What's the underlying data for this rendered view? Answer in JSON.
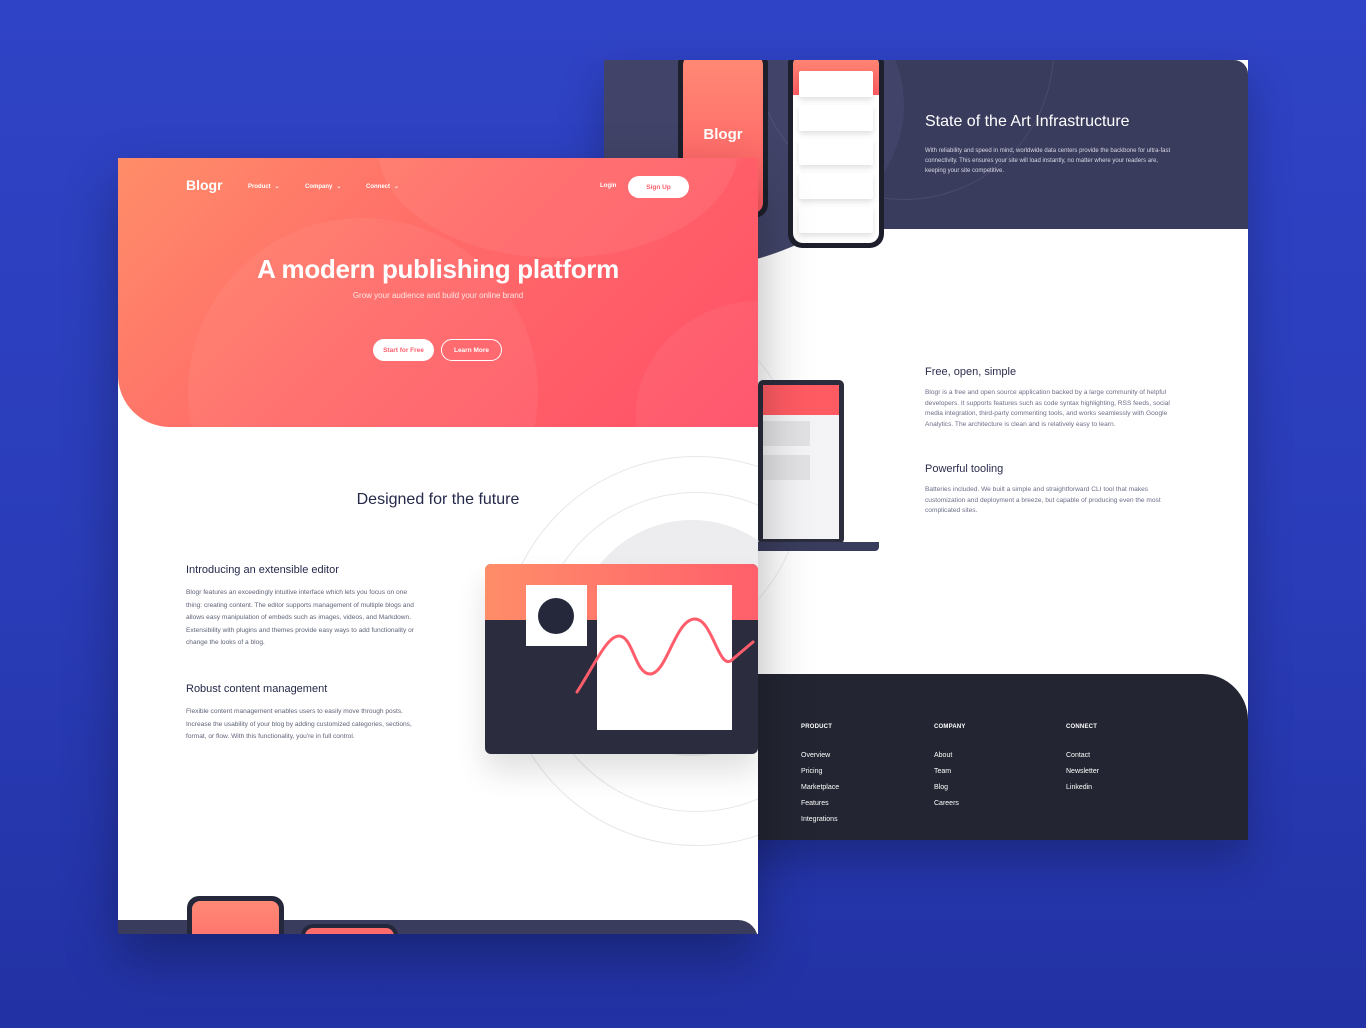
{
  "back": {
    "infra_title": "State of the Art Infrastructure",
    "infra_text": "With reliability and speed in mind, worldwide data centers provide the backbone for ultra-fast connectivity. This ensures your site will load instantly, no matter where your readers are, keeping your site competitive.",
    "phone_logo": "Blogr",
    "free_title": "Free, open, simple",
    "free_text": "Blogr is a free and open source application backed by a large community of helpful developers. It supports features such as code syntax highlighting, RSS feeds, social media integration, third-party commenting tools, and works seamlessly with Google Analytics. The architecture is clean and is relatively easy to learn.",
    "tool_title": "Powerful tooling",
    "tool_text": "Batteries included. We built a simple and straightforward CLI tool that makes customization and deployment a breeze, but capable of producing even the most complicated sites.",
    "footer": {
      "cols": [
        {
          "heading": "PRODUCT",
          "links": [
            "Overview",
            "Pricing",
            "Marketplace",
            "Features",
            "Integrations"
          ]
        },
        {
          "heading": "COMPANY",
          "links": [
            "About",
            "Team",
            "Blog",
            "Careers"
          ]
        },
        {
          "heading": "CONNECT",
          "links": [
            "Contact",
            "Newsletter",
            "Linkedin"
          ]
        }
      ]
    }
  },
  "front": {
    "logo": "Blogr",
    "nav": {
      "product": "Product",
      "company": "Company",
      "connect": "Connect"
    },
    "login": "Login",
    "signup": "Sign Up",
    "hero_title": "A modern publishing platform",
    "hero_sub": "Grow your audience and build your online brand",
    "start_btn": "Start for Free",
    "learn_btn": "Learn More",
    "section_title": "Designed for the future",
    "feat1_title": "Introducing an extensible editor",
    "feat1_text": "Blogr features an exceedingly intuitive interface which lets you focus on one thing: creating content. The editor supports management of multiple blogs and allows easy manipulation of embeds such as images, videos, and Markdown. Extensibility with plugins and themes provide easy ways to add functionality or change the looks of a blog.",
    "feat2_title": "Robust content management",
    "feat2_text": "Flexible content management enables users to easily move through posts. Increase the usability of your blog by adding customized categories, sections, format, or flow. With this functionality, you're in full control."
  },
  "colors": {
    "background": "#2f43c6",
    "accent": "#ff5d6b",
    "dark": "#232532",
    "navy": "#3a3c5d"
  },
  "icons": {
    "nav_chevron": "chevron-down-icon"
  }
}
